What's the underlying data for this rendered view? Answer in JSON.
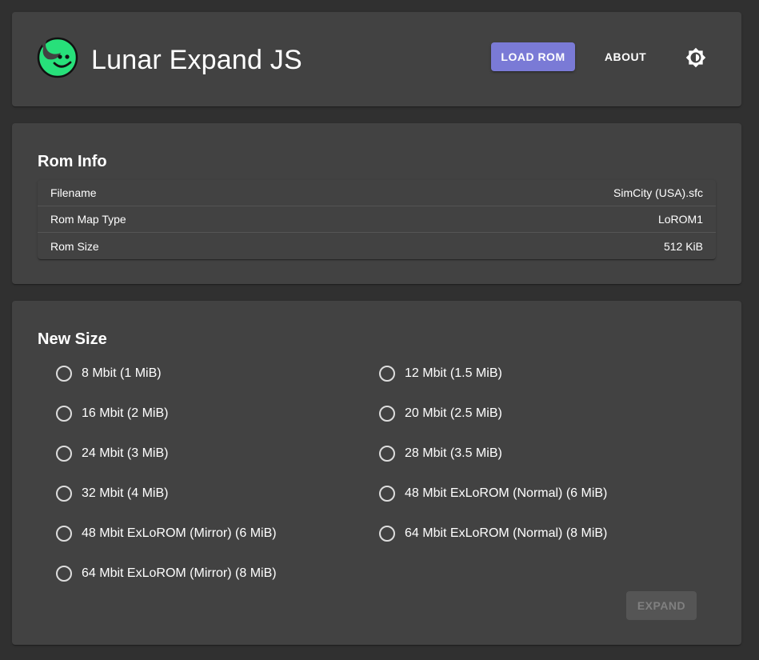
{
  "header": {
    "title": "Lunar Expand JS",
    "load_rom_label": "LOAD ROM",
    "about_label": "ABOUT",
    "logo_icon": "crescent-moon-smiley-logo",
    "theme_icon": "brightness-toggle-icon"
  },
  "rom_info": {
    "title": "Rom Info",
    "rows": [
      {
        "label": "Filename",
        "value": "SimCity (USA).sfc"
      },
      {
        "label": "Rom Map Type",
        "value": "LoROM1"
      },
      {
        "label": "Rom Size",
        "value": "512 KiB"
      }
    ]
  },
  "new_size": {
    "title": "New Size",
    "options": [
      {
        "label": "8 Mbit (1 MiB)",
        "selected": false
      },
      {
        "label": "12 Mbit (1.5 MiB)",
        "selected": false
      },
      {
        "label": "16 Mbit (2 MiB)",
        "selected": false
      },
      {
        "label": "20 Mbit (2.5 MiB)",
        "selected": false
      },
      {
        "label": "24 Mbit (3 MiB)",
        "selected": false
      },
      {
        "label": "28 Mbit (3.5 MiB)",
        "selected": false
      },
      {
        "label": "32 Mbit (4 MiB)",
        "selected": false
      },
      {
        "label": "48 Mbit ExLoROM (Normal) (6 MiB)",
        "selected": false
      },
      {
        "label": "48 Mbit ExLoROM (Mirror) (6 MiB)",
        "selected": false
      },
      {
        "label": "64 Mbit ExLoROM (Normal) (8 MiB)",
        "selected": false
      },
      {
        "label": "64 Mbit ExLoROM (Mirror) (8 MiB)",
        "selected": false
      }
    ],
    "expand_label": "EXPAND",
    "expand_disabled": true
  },
  "colors": {
    "background": "#303030",
    "card": "#424242",
    "accent": "#7a7ad6",
    "logo_green": "#27e07a"
  }
}
